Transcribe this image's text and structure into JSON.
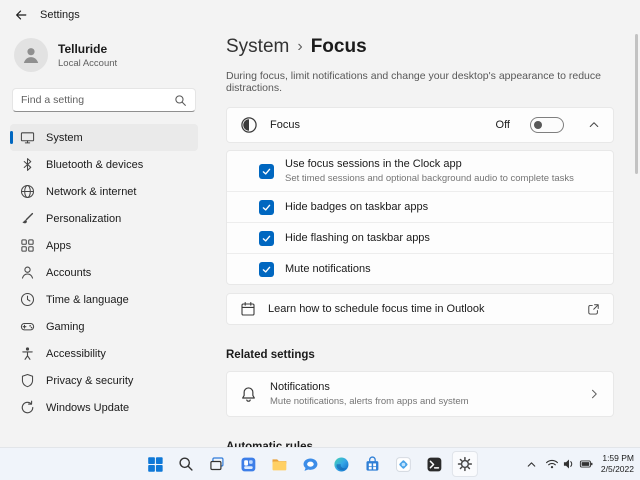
{
  "titlebar": {
    "title": "Settings"
  },
  "sidebar": {
    "user_name": "Telluride",
    "user_type": "Local Account",
    "search_placeholder": "Find a setting",
    "items": [
      {
        "label": "System",
        "icon": "display-icon",
        "selected": true
      },
      {
        "label": "Bluetooth & devices",
        "icon": "bluetooth-icon",
        "selected": false
      },
      {
        "label": "Network & internet",
        "icon": "globe-icon",
        "selected": false
      },
      {
        "label": "Personalization",
        "icon": "brush-icon",
        "selected": false
      },
      {
        "label": "Apps",
        "icon": "apps-grid-icon",
        "selected": false
      },
      {
        "label": "Accounts",
        "icon": "person-icon",
        "selected": false
      },
      {
        "label": "Time & language",
        "icon": "clock-icon",
        "selected": false
      },
      {
        "label": "Gaming",
        "icon": "gamepad-icon",
        "selected": false
      },
      {
        "label": "Accessibility",
        "icon": "accessibility-icon",
        "selected": false
      },
      {
        "label": "Privacy & security",
        "icon": "shield-icon",
        "selected": false
      },
      {
        "label": "Windows Update",
        "icon": "update-arrows-icon",
        "selected": false
      }
    ]
  },
  "main": {
    "breadcrumb_parent": "System",
    "breadcrumb_separator": "›",
    "breadcrumb_current": "Focus",
    "description": "During focus, limit notifications and change your desktop's appearance to reduce distractions.",
    "focus": {
      "label": "Focus",
      "toggle_label": "Off",
      "toggle_on": false,
      "expanded": true,
      "icon": "focus-icon"
    },
    "options": [
      {
        "label": "Use focus sessions in the Clock app",
        "subtitle": "Set timed sessions and optional background audio to complete tasks",
        "checked": true
      },
      {
        "label": "Hide badges on taskbar apps",
        "checked": true
      },
      {
        "label": "Hide flashing on taskbar apps",
        "checked": true
      },
      {
        "label": "Mute notifications",
        "checked": true
      }
    ],
    "learn_label": "Learn how to schedule focus time in Outlook",
    "related_heading": "Related settings",
    "notifications": {
      "label": "Notifications",
      "subtitle": "Mute notifications, alerts from apps and system",
      "icon": "bell-icon"
    },
    "automatic_rules_heading": "Automatic rules"
  },
  "taskbar": {
    "icons": [
      "start",
      "search",
      "task-view",
      "widgets",
      "file-explorer",
      "chat",
      "edge",
      "store",
      "photos",
      "terminal",
      "settings"
    ],
    "active_icon": "settings",
    "time": "1:59 PM",
    "date": "2/5/2022"
  },
  "colors": {
    "accent": "#0067c0",
    "checkbox": "#0067c0",
    "background": "#f3f3f3",
    "card": "#fdfdfd",
    "taskbar": "#f0f4fa"
  }
}
